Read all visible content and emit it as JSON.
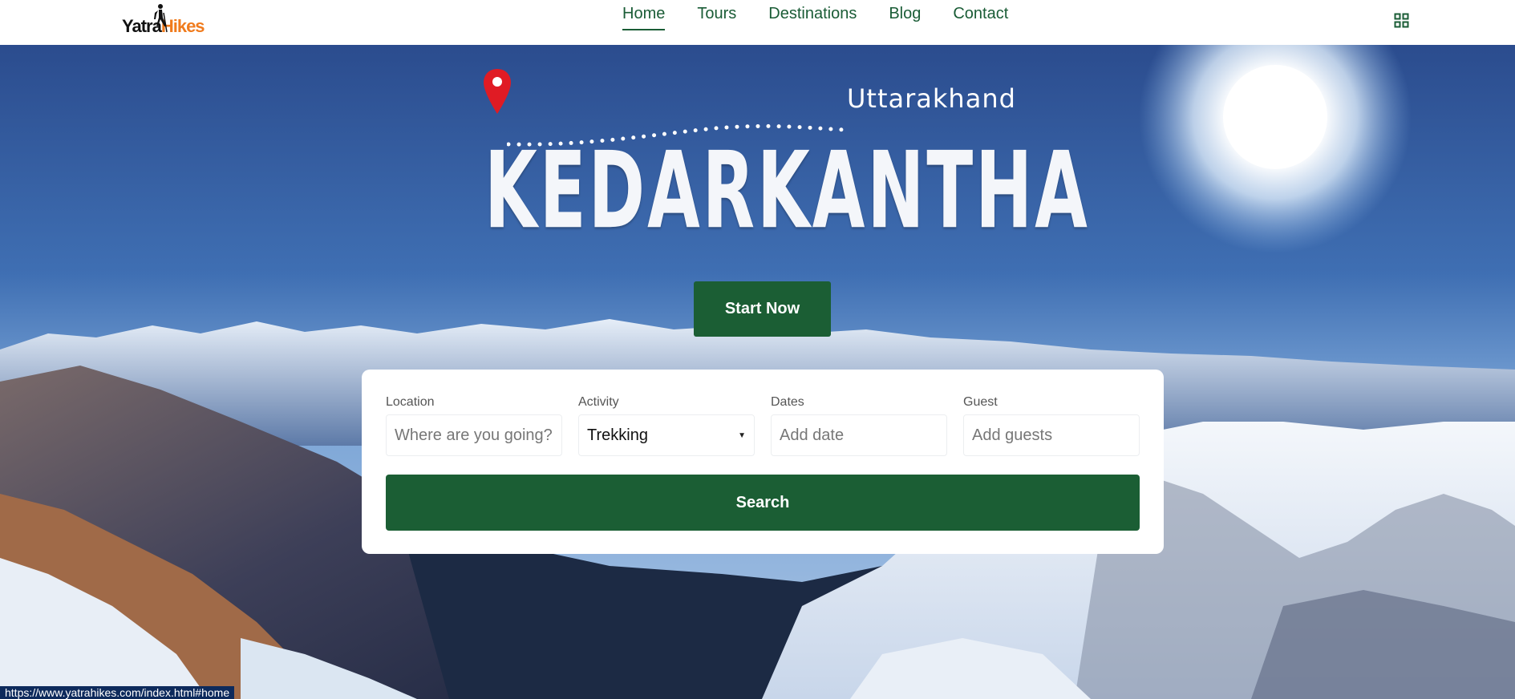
{
  "brand": {
    "name_part1": "Yatra",
    "name_part2": "Hikes",
    "color_accent": "#f07b1d"
  },
  "nav": {
    "items": [
      {
        "label": "Home",
        "active": true
      },
      {
        "label": "Tours"
      },
      {
        "label": "Destinations"
      },
      {
        "label": "Blog"
      },
      {
        "label": "Contact"
      }
    ],
    "menu_icon": "grid-icon"
  },
  "hero": {
    "region": "Uttarakhand",
    "title": "KEDARKANTHA",
    "cta_label": "Start Now",
    "pin_icon": "map-pin-icon"
  },
  "search": {
    "location": {
      "label": "Location",
      "placeholder": "Where are you going?"
    },
    "activity": {
      "label": "Activity",
      "value": "Trekking"
    },
    "dates": {
      "label": "Dates",
      "placeholder": "Add date"
    },
    "guest": {
      "label": "Guest",
      "placeholder": "Add guests"
    },
    "button_label": "Search"
  },
  "status_bar": {
    "url": "https://www.yatrahikes.com/index.html#home"
  },
  "colors": {
    "primary_green": "#1b5e34",
    "nav_text": "#1a5c36"
  }
}
